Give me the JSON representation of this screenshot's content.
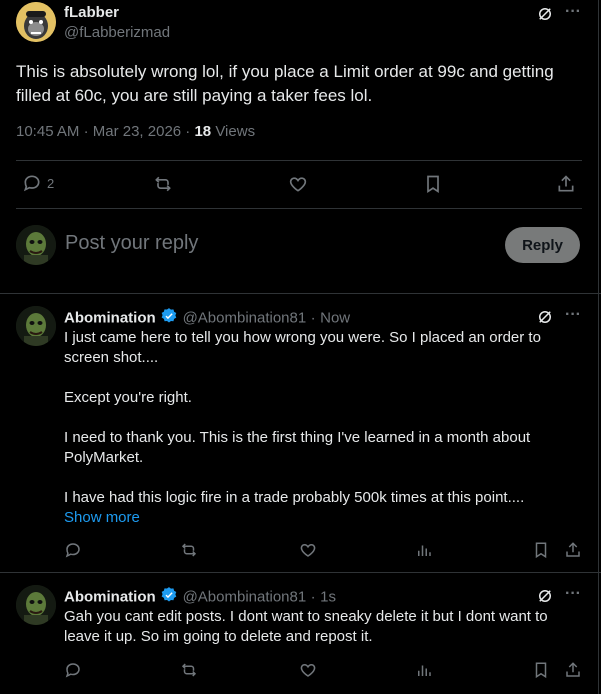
{
  "main_post": {
    "author_name": "fLabber",
    "author_handle": "@fLabberizmad",
    "text": "This is absolutely wrong lol, if you place a Limit order at 99c and getting filled at 60c, you are still paying a taker fees lol.",
    "time": "10:45 AM",
    "sep1": "·",
    "date": "Mar 23, 2026",
    "sep2": "·",
    "views_count": "18",
    "views_label": "Views",
    "reply_count": "2",
    "more_label": "···"
  },
  "composer": {
    "placeholder": "Post your reply",
    "button_label": "Reply"
  },
  "replies": [
    {
      "author_name": "Abomination",
      "author_handle": "@Abombination81",
      "sep": "·",
      "time": "Now",
      "text": "I just came here to tell you how wrong you were.  So I placed an order to screen shot....\n\nExcept you're right.\n\nI need to thank you.  This is the first thing I've learned in a month about PolyMarket.\n\nI have had this logic fire in a trade probably 500k times at this point....",
      "show_more": "Show more",
      "more_label": "···"
    },
    {
      "author_name": "Abomination",
      "author_handle": "@Abombination81",
      "sep": "·",
      "time": "1s",
      "text": "Gah you cant edit posts.  I dont want to sneaky delete it but I dont want to leave it up.  So im going to delete and repost it.",
      "more_label": "···"
    }
  ],
  "colors": {
    "background": "#000000",
    "text": "#e7e9ea",
    "muted": "#71767b",
    "divider": "#2f3336",
    "link": "#1d9bf0",
    "verified": "#1d9bf0",
    "reply_button": "#787a7a"
  },
  "icons": {
    "grok": "grok-icon",
    "more": "more-icon",
    "reply": "reply-icon",
    "repost": "repost-icon",
    "like": "like-icon",
    "bookmark": "bookmark-icon",
    "share": "share-icon",
    "analytics": "analytics-icon",
    "verified": "verified-badge-icon"
  }
}
